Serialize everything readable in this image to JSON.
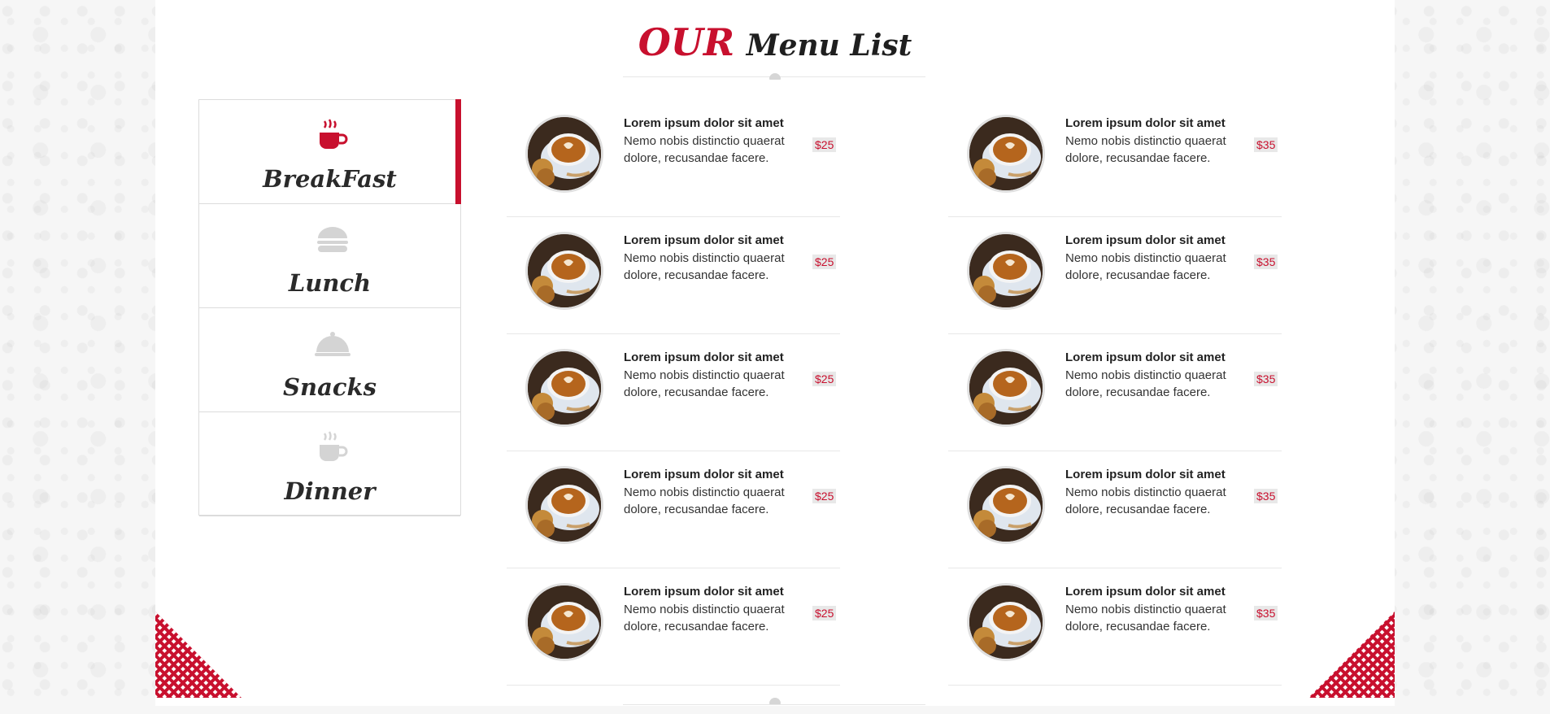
{
  "heading": {
    "accent": "OUR",
    "rest": "Menu List"
  },
  "tabs": [
    {
      "label": "BreakFast",
      "icon": "coffee-cup-icon",
      "active": true
    },
    {
      "label": "Lunch",
      "icon": "burger-icon",
      "active": false
    },
    {
      "label": "Snacks",
      "icon": "cloche-icon",
      "active": false
    },
    {
      "label": "Dinner",
      "icon": "coffee-cup-icon",
      "active": false
    }
  ],
  "colors": {
    "accent": "#c8102e",
    "inactive_icon": "#d4d4d4"
  },
  "menu": {
    "left": [
      {
        "title": "Lorem ipsum dolor sit amet",
        "desc": "Nemo nobis distinctio quaerat dolore, recusandae facere.",
        "price": "$25"
      },
      {
        "title": "Lorem ipsum dolor sit amet",
        "desc": "Nemo nobis distinctio quaerat dolore, recusandae facere.",
        "price": "$25"
      },
      {
        "title": "Lorem ipsum dolor sit amet",
        "desc": "Nemo nobis distinctio quaerat dolore, recusandae facere.",
        "price": "$25"
      },
      {
        "title": "Lorem ipsum dolor sit amet",
        "desc": "Nemo nobis distinctio quaerat dolore, recusandae facere.",
        "price": "$25"
      },
      {
        "title": "Lorem ipsum dolor sit amet",
        "desc": "Nemo nobis distinctio quaerat dolore, recusandae facere.",
        "price": "$25"
      }
    ],
    "right": [
      {
        "title": "Lorem ipsum dolor sit amet",
        "desc": "Nemo nobis distinctio quaerat dolore, recusandae facere.",
        "price": "$35"
      },
      {
        "title": "Lorem ipsum dolor sit amet",
        "desc": "Nemo nobis distinctio quaerat dolore, recusandae facere.",
        "price": "$35"
      },
      {
        "title": "Lorem ipsum dolor sit amet",
        "desc": "Nemo nobis distinctio quaerat dolore, recusandae facere.",
        "price": "$35"
      },
      {
        "title": "Lorem ipsum dolor sit amet",
        "desc": "Nemo nobis distinctio quaerat dolore, recusandae facere.",
        "price": "$35"
      },
      {
        "title": "Lorem ipsum dolor sit amet",
        "desc": "Nemo nobis distinctio quaerat dolore, recusandae facere.",
        "price": "$35"
      }
    ]
  }
}
